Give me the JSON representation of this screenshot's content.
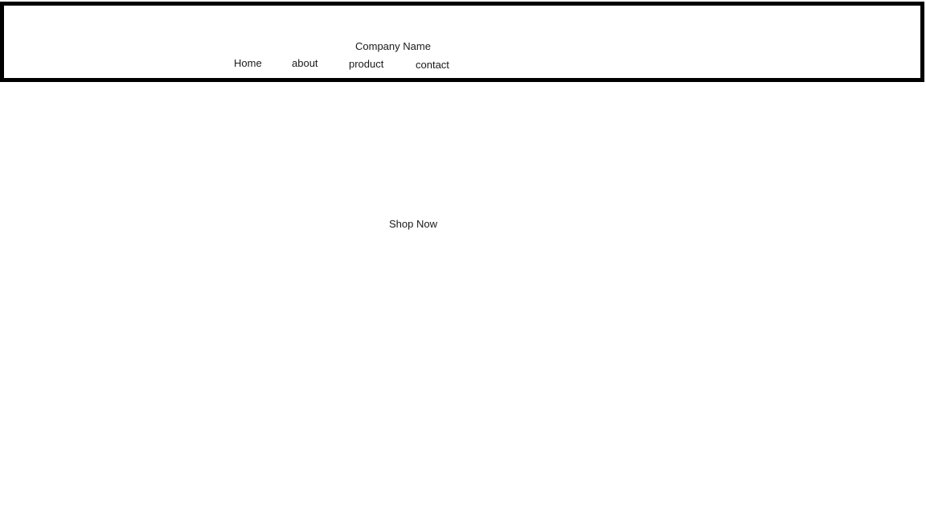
{
  "header": {
    "company_name": "Company Name",
    "nav": {
      "home": "Home",
      "about": "about",
      "product": "product",
      "contact": "contact"
    }
  },
  "hero": {
    "cta_label": "Shop Now"
  },
  "colors": {
    "border": "#000000",
    "background": "#ffffff",
    "text": "#1a1a1a"
  }
}
